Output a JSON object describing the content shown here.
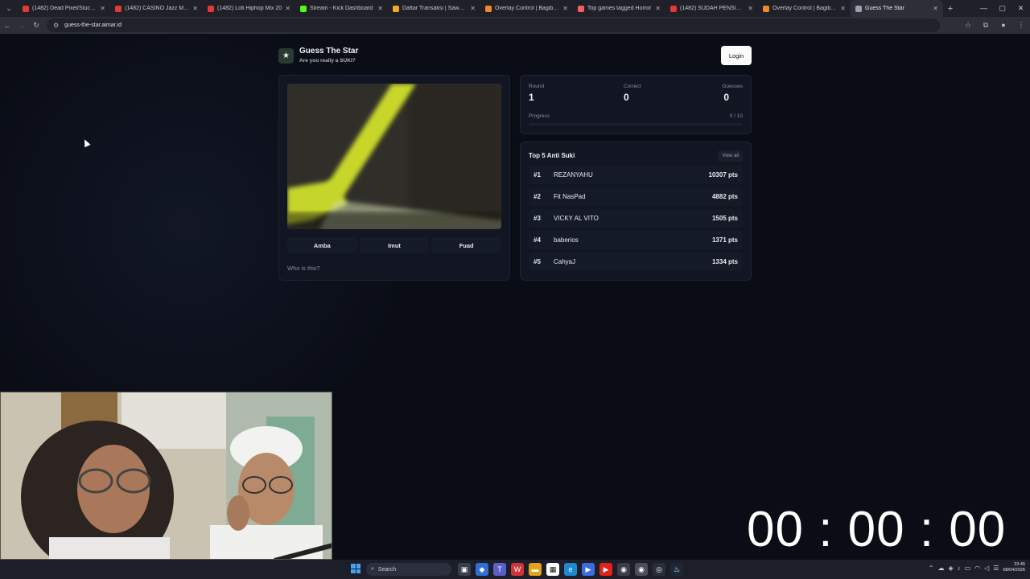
{
  "browser": {
    "tabs": [
      {
        "title": "(1482) Dead Pixel/Stuck Pixel",
        "fav_color": "#e53935"
      },
      {
        "title": "(1482) CASINO Jazz Music",
        "fav_color": "#e53935"
      },
      {
        "title": "(1482) Lofi Hiphop Mix 20",
        "fav_color": "#e53935"
      },
      {
        "title": "Stream - Kick Dashboard",
        "fav_color": "#53fc18"
      },
      {
        "title": "Daftar Transaksi | Saweria",
        "fav_color": "#f5a623"
      },
      {
        "title": "Overlay Control | Bagibagi.co",
        "fav_color": "#f08a24"
      },
      {
        "title": "Top games tagged Horror",
        "fav_color": "#fa5c5c"
      },
      {
        "title": "(1482) SUDAH PENSIUN WA",
        "fav_color": "#e53935"
      },
      {
        "title": "Overlay Control | Bagibagi.co",
        "fav_color": "#f08a24"
      },
      {
        "title": "Guess The Star",
        "fav_color": "#9aa0ae"
      }
    ],
    "url": "guess-the-star.aimar.id"
  },
  "header": {
    "logo_glyph": "★",
    "title": "Guess The Star",
    "subtitle": "Are you really a SUKI?",
    "login_label": "Login"
  },
  "game": {
    "answers": [
      "Amba",
      "Imut",
      "Fuad"
    ],
    "prompt": "Who is this?"
  },
  "stats": {
    "round_label": "Round",
    "round_value": "1",
    "correct_label": "Correct",
    "correct_value": "0",
    "guesses_label": "Guesses",
    "guesses_value": "0",
    "progress_label": "Progress",
    "progress_count": "0 / 10",
    "progress_fraction": 0
  },
  "leaderboard": {
    "title": "Top 5 Anti Suki",
    "view_all_label": "View all",
    "rows": [
      {
        "rank": "#1",
        "name": "REZANYAHU",
        "points": "10307 pts"
      },
      {
        "rank": "#2",
        "name": "Fit NasPad",
        "points": "4882 pts"
      },
      {
        "rank": "#3",
        "name": "VICKY AL VITO",
        "points": "1505 pts"
      },
      {
        "rank": "#4",
        "name": "baberios",
        "points": "1371 pts"
      },
      {
        "rank": "#5",
        "name": "CahyaJ",
        "points": "1334 pts"
      }
    ]
  },
  "timer": "00 : 00 : 00",
  "taskbar": {
    "search_label": "Search",
    "time": "23:45",
    "date": "08/04/2026"
  }
}
